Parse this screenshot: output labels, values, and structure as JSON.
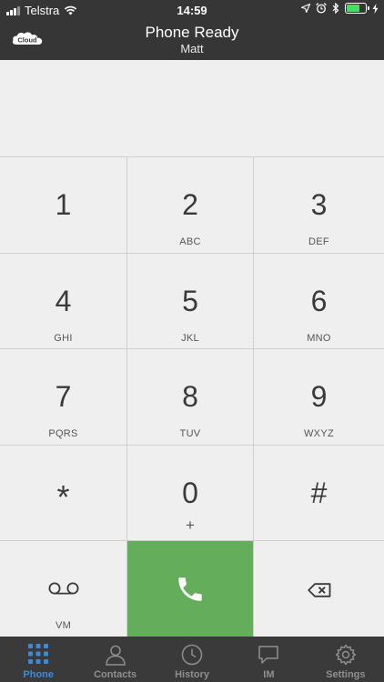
{
  "status_bar": {
    "carrier": "Telstra",
    "time": "14:59",
    "battery_level": 0.68,
    "colors": {
      "battery": "#4cd964"
    }
  },
  "header": {
    "logo_text": "Cloud",
    "title": "Phone Ready",
    "subtitle": "Matt",
    "background": "#363636"
  },
  "dialer": {
    "number": "",
    "keys": [
      {
        "digit": "1",
        "letters": ""
      },
      {
        "digit": "2",
        "letters": "ABC"
      },
      {
        "digit": "3",
        "letters": "DEF"
      },
      {
        "digit": "4",
        "letters": "GHI"
      },
      {
        "digit": "5",
        "letters": "JKL"
      },
      {
        "digit": "6",
        "letters": "MNO"
      },
      {
        "digit": "7",
        "letters": "PQRS"
      },
      {
        "digit": "8",
        "letters": "TUV"
      },
      {
        "digit": "9",
        "letters": "WXYZ"
      },
      {
        "digit": "*",
        "letters": ""
      },
      {
        "digit": "0",
        "letters": "+"
      },
      {
        "digit": "#",
        "letters": ""
      }
    ],
    "voicemail_label": "VM",
    "call_icon": "phone-handset-icon",
    "delete_icon": "backspace-icon",
    "call_color": "#63ad5b"
  },
  "tabbar": {
    "active_color": "#3d8bd7",
    "tabs": [
      {
        "label": "Phone",
        "icon": "keypad-grid-icon",
        "active": true
      },
      {
        "label": "Contacts",
        "icon": "person-icon",
        "active": false
      },
      {
        "label": "History",
        "icon": "clock-icon",
        "active": false
      },
      {
        "label": "IM",
        "icon": "chat-bubble-icon",
        "active": false
      },
      {
        "label": "Settings",
        "icon": "gear-icon",
        "active": false
      }
    ]
  }
}
